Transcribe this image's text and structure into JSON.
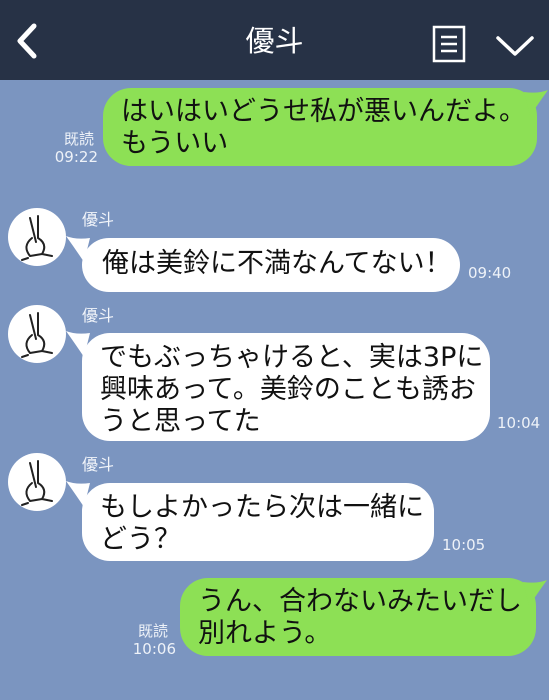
{
  "header": {
    "title": "優斗"
  },
  "messages": [
    {
      "side": "out",
      "text": "はいはいどうせ私が悪いんだよ。\nもういい",
      "read": "既読",
      "time": "09:22"
    },
    {
      "side": "in",
      "sender": "優斗",
      "text": "俺は美鈴に不満なんてない！",
      "time": "09:40"
    },
    {
      "side": "in",
      "sender": "優斗",
      "text": "でもぶっちゃけると、実は3Pに\n興味あって。美鈴のことも誘お\nうと思ってた",
      "time": "10:04"
    },
    {
      "side": "in",
      "sender": "優斗",
      "text": "もしよかったら次は一緒に\nどう？",
      "time": "10:05"
    },
    {
      "side": "out",
      "text": "うん、合わないみたいだし\n別れよう。",
      "read": "既読",
      "time": "10:06"
    }
  ],
  "colors": {
    "background": "#7b95c0",
    "header": "#273246",
    "outgoing_bubble": "#8de055",
    "incoming_bubble": "#ffffff"
  },
  "icons": {
    "back": "chevron-left-icon",
    "notes": "notes-icon",
    "menu": "chevron-down-icon",
    "avatar": "rabbit-sketch-avatar"
  }
}
